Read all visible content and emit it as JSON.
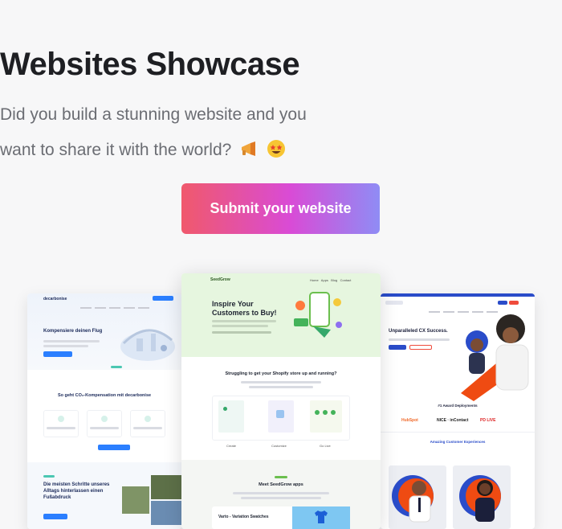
{
  "hero": {
    "title": "Websites Showcase",
    "subtitle_line1": "Did you build a stunning website and you",
    "subtitle_line2": "want to share it with the world?",
    "emojis": [
      "megaphone-emoji",
      "star-struck-emoji"
    ]
  },
  "cta": {
    "label": "Submit your website"
  },
  "colors": {
    "cta_gradient": [
      "#f0596c",
      "#d94bd6",
      "#8f8cf5"
    ],
    "title": "#1e1f23",
    "subtitle": "#6b6d73"
  },
  "previews": {
    "left": {
      "brand": "decarbonise",
      "hero_heading": "Kompensiere deinen Flug",
      "section_heading": "So geht CO₂-Kompensation mit decarbonise",
      "bottom_heading": "Die meisten Schritte unseres Alltags hinterlassen einen Fußabdruck"
    },
    "middle": {
      "brand": "SeedGrow",
      "nav": [
        "Home",
        "Apps",
        "Blog",
        "Contact"
      ],
      "hero_heading_line1": "Inspire Your",
      "hero_heading_line2": "Customers to Buy!",
      "section_heading": "Struggling to get your Shopify store up and running?",
      "steps": [
        "Create",
        "Customize",
        "Go Live"
      ],
      "apps_heading": "Meet SeedGrow apps",
      "app_title": "Varto - Variation Swatches"
    },
    "right": {
      "hero_heading": "Unparalleled CX Success.",
      "logos_heading": "#1 Award Deployments",
      "logos": [
        "HubSpot",
        "NICE · inContact",
        "PD LIVE"
      ],
      "testimonial_heading": "Amazing Customer Experiences"
    }
  }
}
